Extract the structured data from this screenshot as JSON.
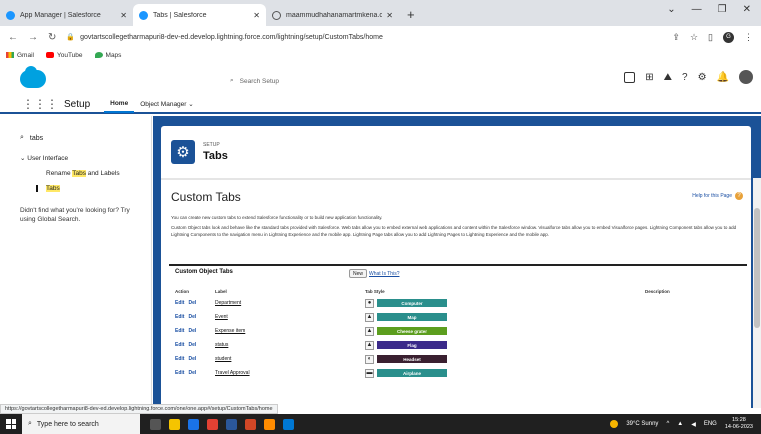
{
  "browser": {
    "tabs": [
      {
        "title": "App Manager | Salesforce",
        "icon": "salesforce-cloud-icon",
        "active": false
      },
      {
        "title": "Tabs | Salesforce",
        "icon": "salesforce-cloud-icon",
        "active": true
      },
      {
        "title": "maammudhahanamartmkena.co",
        "icon": "globe-icon",
        "active": false
      }
    ],
    "url": "govtartscollegetharmapuri8-dev-ed.develop.lightning.force.com/lightning/setup/CustomTabs/home",
    "bookmarks": [
      {
        "label": "Gmail",
        "icon": "gmail-icon"
      },
      {
        "label": "YouTube",
        "icon": "youtube-icon"
      },
      {
        "label": "Maps",
        "icon": "maps-icon"
      }
    ]
  },
  "sf": {
    "search_placeholder": "Search Setup",
    "app_name": "Setup",
    "nav_tabs": [
      {
        "label": "Home",
        "active": true
      },
      {
        "label": "Object Manager",
        "active": false
      }
    ]
  },
  "sidebar": {
    "quick_find_value": "tabs",
    "group_label": "User Interface",
    "items": [
      {
        "label_pre": "Rename ",
        "label_hl": "Tabs",
        "label_post": " and Labels"
      },
      {
        "label_pre": "",
        "label_hl": "Tabs",
        "label_post": ""
      }
    ],
    "not_found_text": "Didn't find what you're looking for? Try using Global Search."
  },
  "page": {
    "eyebrow": "SETUP",
    "title": "Tabs",
    "content_title": "Custom Tabs",
    "help_link": "Help for this Page",
    "desc1": "You can create new custom tabs to extend Salesforce functionality or to build new application functionality.",
    "desc2": "Custom Object tabs look and behave like the standard tabs provided with Salesforce. Web tabs allow you to embed external web applications and content within the Salesforce window. Visualforce tabs allow you to embed Visualforce pages. Lightning Component tabs allow you to add Lightning Components to the navigation menu in Lightning Experience and the mobile app. Lightning Page tabs allow you to add Lightning Pages to Lightning Experience and the mobile app.",
    "section_title": "Custom Object Tabs",
    "new_button": "New",
    "what_is_this": "What Is This?",
    "columns": [
      "Action",
      "Label",
      "Tab Style",
      "Description"
    ],
    "rows": [
      {
        "edit": "Edit",
        "del": "Del",
        "label": "Department",
        "style_name": "Computer",
        "style_icon": "●",
        "color": "#2a8f8c"
      },
      {
        "edit": "Edit",
        "del": "Del",
        "label": "Event",
        "style_name": "Map",
        "style_icon": "▲",
        "color": "#2a8f8c"
      },
      {
        "edit": "Edit",
        "del": "Del",
        "label": "Expense item",
        "style_name": "Cheese grater",
        "style_icon": "▲",
        "color": "#5c9e1e"
      },
      {
        "edit": "Edit",
        "del": "Del",
        "label": "status",
        "style_name": "Flag",
        "style_icon": "▲",
        "color": "#3b2a8a"
      },
      {
        "edit": "Edit",
        "del": "Del",
        "label": "student",
        "style_name": "Headset",
        "style_icon": "◐",
        "color": "#3a2030"
      },
      {
        "edit": "Edit",
        "del": "Del",
        "label": "Travel Approval",
        "style_name": "Airplane",
        "style_icon": "▬",
        "color": "#2a8f8c"
      }
    ]
  },
  "status_url": "https://govtartscollegetharmapuri8-dev-ed.develop.lightning.force.com/one/one.app#/setup/CustomTabs/home",
  "taskbar": {
    "search_placeholder": "Type here to search",
    "weather": "39°C Sunny",
    "lang": "ENG",
    "time": "15:28",
    "date": "14-06-2023"
  }
}
